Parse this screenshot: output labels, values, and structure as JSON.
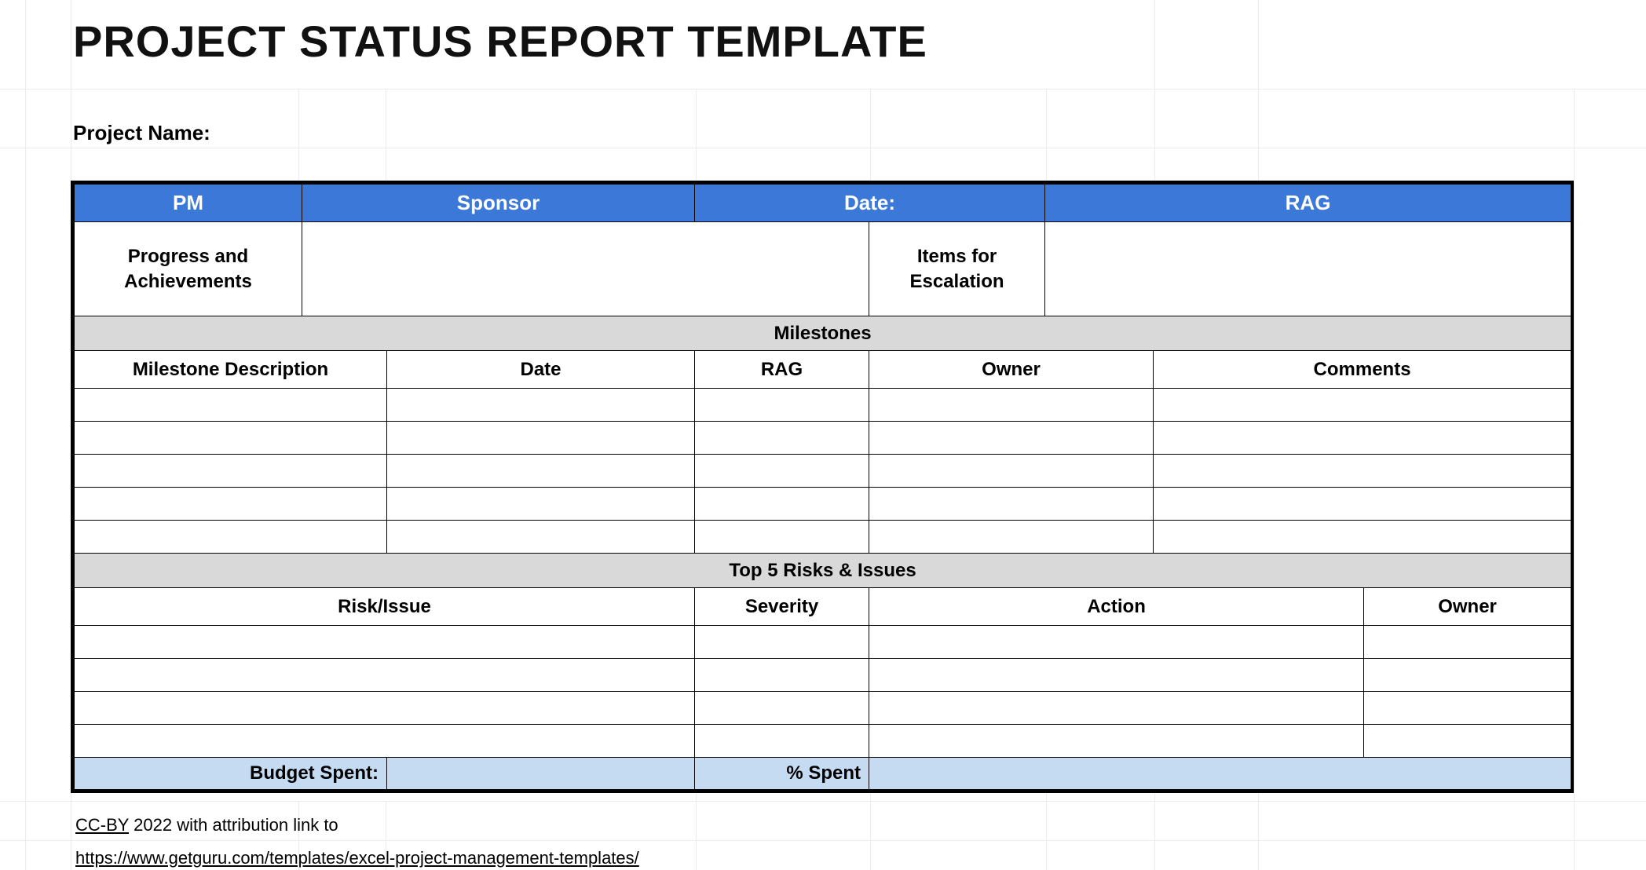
{
  "title": "PROJECT STATUS REPORT TEMPLATE",
  "labels": {
    "project_name": "Project  Name:",
    "pm": "PM",
    "sponsor": "Sponsor",
    "date": "Date:",
    "rag": "RAG",
    "progress_line1": "Progress and",
    "progress_line2": "Achievements",
    "escalation_line1": "Items for",
    "escalation_line2": "Escalation",
    "milestones_section": "Milestones",
    "risks_section": "Top 5 Risks & Issues",
    "budget_spent": "Budget Spent:",
    "percent_spent": "% Spent"
  },
  "milestones": {
    "headers": {
      "description": "Milestone Description",
      "date": "Date",
      "rag": "RAG",
      "owner": "Owner",
      "comments": "Comments"
    },
    "rows": [
      {
        "description": "",
        "date": "",
        "rag": "",
        "owner": "",
        "comments": ""
      },
      {
        "description": "",
        "date": "",
        "rag": "",
        "owner": "",
        "comments": ""
      },
      {
        "description": "",
        "date": "",
        "rag": "",
        "owner": "",
        "comments": ""
      },
      {
        "description": "",
        "date": "",
        "rag": "",
        "owner": "",
        "comments": ""
      },
      {
        "description": "",
        "date": "",
        "rag": "",
        "owner": "",
        "comments": ""
      }
    ]
  },
  "risks": {
    "headers": {
      "risk_issue": "Risk/Issue",
      "severity": "Severity",
      "action": "Action",
      "owner": "Owner"
    },
    "rows": [
      {
        "risk_issue": "",
        "severity": "",
        "action": "",
        "owner": ""
      },
      {
        "risk_issue": "",
        "severity": "",
        "action": "",
        "owner": ""
      },
      {
        "risk_issue": "",
        "severity": "",
        "action": "",
        "owner": ""
      },
      {
        "risk_issue": "",
        "severity": "",
        "action": "",
        "owner": ""
      }
    ]
  },
  "values": {
    "project_name": "",
    "pm": "",
    "sponsor": "",
    "date": "",
    "rag": "",
    "progress": "",
    "escalation": "",
    "budget_spent": "",
    "percent_spent": ""
  },
  "footer": {
    "ccby": "CC-BY",
    "rest": " 2022 with attribution link to",
    "link": "https://www.getguru.com/templates/excel-project-management-templates/"
  }
}
